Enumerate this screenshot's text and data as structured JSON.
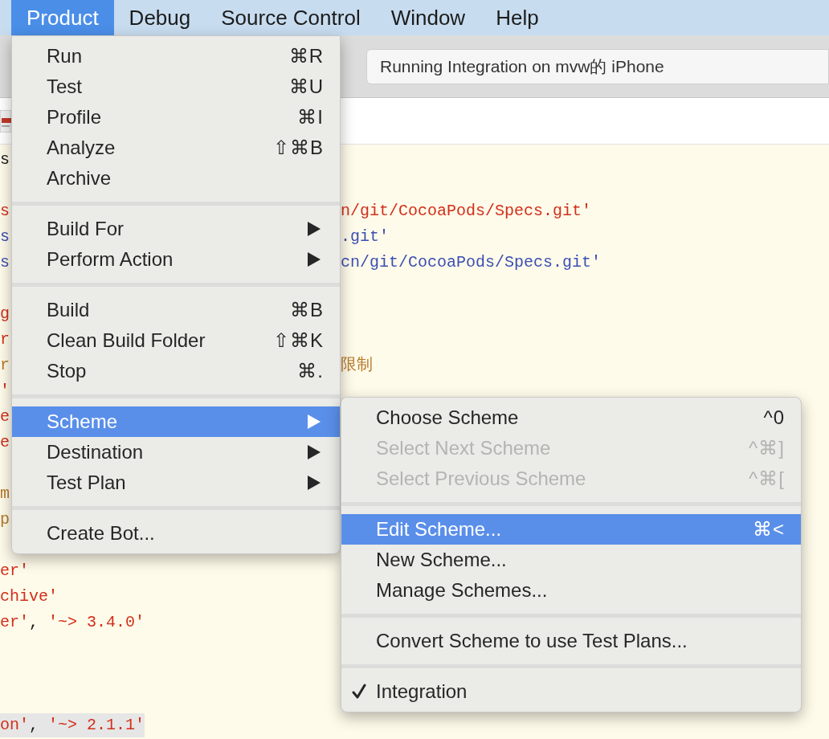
{
  "menu_bar": [
    {
      "label": "Product",
      "selected": true
    },
    {
      "label": "Debug",
      "selected": false
    },
    {
      "label": "Source Control",
      "selected": false
    },
    {
      "label": "Window",
      "selected": false
    },
    {
      "label": "Help",
      "selected": false
    }
  ],
  "activity_field": {
    "value": "Running Integration on mvw的 iPhone"
  },
  "editor_lines": [
    {
      "highlighted": false,
      "left": [
        {
          "text": "s",
          "kind": "plain"
        }
      ]
    },
    {
      "highlighted": false
    },
    {
      "highlighted": false,
      "left": [
        {
          "text": "s",
          "kind": "string"
        }
      ],
      "right": [
        {
          "text": "n/git/CocoaPods/Specs.git'",
          "kind": "string"
        }
      ]
    },
    {
      "highlighted": false,
      "left": [
        {
          "text": "s",
          "kind": "url"
        }
      ],
      "right": [
        {
          "text": ".git'",
          "kind": "url"
        }
      ]
    },
    {
      "highlighted": false,
      "left": [
        {
          "text": "s",
          "kind": "url"
        }
      ],
      "right": [
        {
          "text": "cn/git/CocoaPods/Specs.git'",
          "kind": "url"
        }
      ]
    },
    {
      "highlighted": false
    },
    {
      "highlighted": false,
      "left": [
        {
          "text": "g",
          "kind": "string"
        }
      ]
    },
    {
      "highlighted": false,
      "left": [
        {
          "text": "r",
          "kind": "string"
        }
      ]
    },
    {
      "highlighted": false,
      "left": [
        {
          "text": "r",
          "kind": "comment"
        }
      ],
      "right": [
        {
          "text": "限制",
          "kind": "comment"
        }
      ]
    },
    {
      "highlighted": false,
      "left": [
        {
          "text": "'",
          "kind": "string"
        }
      ]
    },
    {
      "highlighted": false,
      "left": [
        {
          "text": "e",
          "kind": "string"
        }
      ]
    },
    {
      "highlighted": false,
      "left": [
        {
          "text": "e",
          "kind": "string"
        }
      ]
    },
    {
      "highlighted": false
    },
    {
      "highlighted": false,
      "left": [
        {
          "text": "m",
          "kind": "comment"
        }
      ]
    },
    {
      "highlighted": false,
      "left": [
        {
          "text": "p",
          "kind": "comment"
        }
      ]
    },
    {
      "highlighted": false
    },
    {
      "highlighted": false,
      "left": [
        {
          "text": "er'",
          "kind": "string"
        }
      ]
    },
    {
      "highlighted": false,
      "left": [
        {
          "text": "chive'",
          "kind": "string"
        }
      ]
    },
    {
      "highlighted": false,
      "left": [
        {
          "text": "er'",
          "kind": "string"
        },
        {
          "text": ", ",
          "kind": "plain"
        },
        {
          "text": "'~> 3.4.0'",
          "kind": "string"
        }
      ]
    },
    {
      "highlighted": false
    },
    {
      "highlighted": false
    },
    {
      "highlighted": false
    },
    {
      "highlighted": true,
      "left": [
        {
          "text": "on'",
          "kind": "string"
        },
        {
          "text": ", ",
          "kind": "plain"
        },
        {
          "text": "'~> 2.1.1'",
          "kind": "string"
        }
      ]
    }
  ],
  "product_menu": [
    {
      "kind": "item",
      "label": "Run",
      "shortcut": "⌘R",
      "selected": false,
      "disabled": false
    },
    {
      "kind": "item",
      "label": "Test",
      "shortcut": "⌘U",
      "selected": false,
      "disabled": false
    },
    {
      "kind": "item",
      "label": "Profile",
      "shortcut": "⌘I",
      "selected": false,
      "disabled": false
    },
    {
      "kind": "item",
      "label": "Analyze",
      "shortcut": "⇧⌘B",
      "selected": false,
      "disabled": false
    },
    {
      "kind": "item",
      "label": "Archive",
      "selected": false,
      "disabled": false
    },
    {
      "kind": "separator"
    },
    {
      "kind": "submenu",
      "label": "Build For",
      "selected": false,
      "disabled": false
    },
    {
      "kind": "submenu",
      "label": "Perform Action",
      "selected": false,
      "disabled": false
    },
    {
      "kind": "separator"
    },
    {
      "kind": "item",
      "label": "Build",
      "shortcut": "⌘B",
      "selected": false,
      "disabled": false
    },
    {
      "kind": "item",
      "label": "Clean Build Folder",
      "shortcut": "⇧⌘K",
      "selected": false,
      "disabled": false
    },
    {
      "kind": "item",
      "label": "Stop",
      "shortcut": "⌘.",
      "selected": false,
      "disabled": false
    },
    {
      "kind": "separator"
    },
    {
      "kind": "submenu",
      "label": "Scheme",
      "selected": true,
      "disabled": false
    },
    {
      "kind": "submenu",
      "label": "Destination",
      "selected": false,
      "disabled": false
    },
    {
      "kind": "submenu",
      "label": "Test Plan",
      "selected": false,
      "disabled": false
    },
    {
      "kind": "separator"
    },
    {
      "kind": "item",
      "label": "Create Bot...",
      "selected": false,
      "disabled": false
    }
  ],
  "scheme_menu": [
    {
      "kind": "item",
      "label": "Choose Scheme",
      "shortcut": "^0",
      "selected": false,
      "disabled": false,
      "checked": false
    },
    {
      "kind": "item",
      "label": "Select Next Scheme",
      "shortcut": "^⌘]",
      "selected": false,
      "disabled": true,
      "checked": false
    },
    {
      "kind": "item",
      "label": "Select Previous Scheme",
      "shortcut": "^⌘[",
      "selected": false,
      "disabled": true,
      "checked": false
    },
    {
      "kind": "separator"
    },
    {
      "kind": "item",
      "label": "Edit Scheme...",
      "shortcut": "⌘<",
      "selected": true,
      "disabled": false,
      "checked": false
    },
    {
      "kind": "item",
      "label": "New Scheme...",
      "selected": false,
      "disabled": false,
      "checked": false
    },
    {
      "kind": "item",
      "label": "Manage Schemes...",
      "selected": false,
      "disabled": false,
      "checked": false
    },
    {
      "kind": "separator"
    },
    {
      "kind": "item",
      "label": "Convert Scheme to use Test Plans...",
      "selected": false,
      "disabled": false,
      "checked": false
    },
    {
      "kind": "separator"
    },
    {
      "kind": "item",
      "label": "Integration",
      "selected": false,
      "disabled": false,
      "checked": true
    }
  ]
}
